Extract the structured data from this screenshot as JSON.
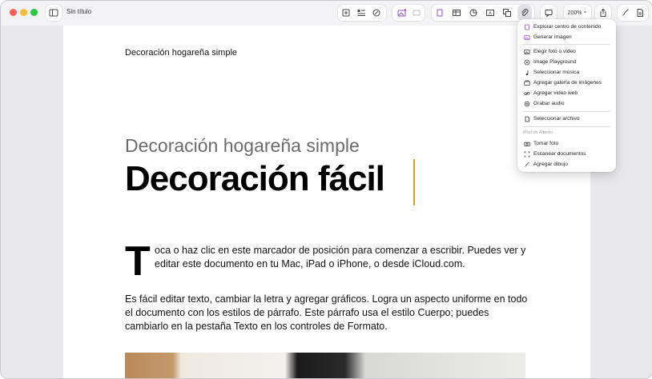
{
  "window": {
    "title": "Sin título"
  },
  "toolbar": {
    "zoom": "200%"
  },
  "document": {
    "header": "Decoración hogareña simple",
    "subtitle": "Decoración hogareña simple",
    "title": "Decoración fácil",
    "dropcap": "T",
    "para1": "oca o haz clic en este marcador de posición para comenzar a escribir. Puedes ver y editar este documento en tu Mac, iPad o iPhone, o desde iCloud.com.",
    "para2": "Es fácil editar texto, cambiar la letra y agregar gráficos. Logra un aspecto uniforme en todo el documento con los estilos de párrafo. Este párrafo usa el estilo Cuerpo; puedes cambiarlo en la pestaña Texto en los controles de Formato."
  },
  "menu": {
    "items": [
      {
        "label": "Explorar centro de contenido",
        "icon": "content-hub-icon"
      },
      {
        "label": "Generar imagen",
        "icon": "image-gen-icon"
      },
      {
        "label": "Elegir foto o video",
        "icon": "photo-icon"
      },
      {
        "label": "Image Playground",
        "icon": "playground-icon"
      },
      {
        "label": "Seleccionar música",
        "icon": "music-icon"
      },
      {
        "label": "Agregar galería de imágenes",
        "icon": "gallery-icon"
      },
      {
        "label": "Agregar video web",
        "icon": "web-video-icon"
      },
      {
        "label": "Grabar audio",
        "icon": "audio-icon"
      },
      {
        "label": "Seleccionar archivo",
        "icon": "file-icon"
      },
      {
        "label": "Tomar foto",
        "icon": "camera-icon"
      },
      {
        "label": "Escanear documentos",
        "icon": "scan-icon"
      },
      {
        "label": "Agregar dibujo",
        "icon": "drawing-icon"
      }
    ],
    "section_label": "iPad de Alberto"
  }
}
